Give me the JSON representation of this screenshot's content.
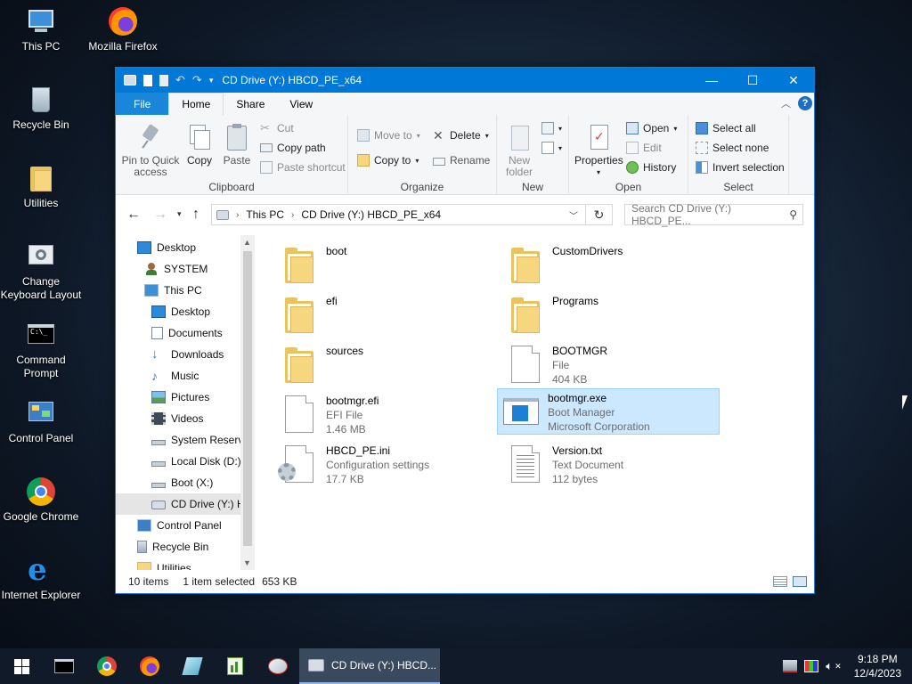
{
  "desktop": {
    "icons": [
      {
        "label": "This PC"
      },
      {
        "label": "Mozilla Firefox"
      },
      {
        "label": "Recycle Bin"
      },
      {
        "label": "Utilities"
      },
      {
        "label": "Change Keyboard Layout"
      },
      {
        "label": "Command Prompt"
      },
      {
        "label": "Control Panel"
      },
      {
        "label": "Google Chrome"
      },
      {
        "label": "Internet Explorer"
      }
    ]
  },
  "window": {
    "title": "CD Drive (Y:) HBCD_PE_x64",
    "minimize": "—",
    "maximize": "☐",
    "close": "✕"
  },
  "ribbon": {
    "tabs": {
      "file": "File",
      "home": "Home",
      "share": "Share",
      "view": "View"
    },
    "clipboard": {
      "label": "Clipboard",
      "pin": "Pin to Quick access",
      "copy": "Copy",
      "paste": "Paste",
      "cut": "Cut",
      "copy_path": "Copy path",
      "paste_shortcut": "Paste shortcut"
    },
    "organize": {
      "label": "Organize",
      "move_to": "Move to",
      "copy_to": "Copy to",
      "delete": "Delete",
      "rename": "Rename"
    },
    "new": {
      "label": "New",
      "new_folder": "New folder"
    },
    "open": {
      "label": "Open",
      "properties": "Properties",
      "open": "Open",
      "edit": "Edit",
      "history": "History"
    },
    "select": {
      "label": "Select",
      "select_all": "Select all",
      "select_none": "Select none",
      "invert": "Invert selection"
    }
  },
  "address": {
    "crumbs": [
      "This PC",
      "CD Drive (Y:) HBCD_PE_x64"
    ],
    "search_placeholder": "Search CD Drive (Y:) HBCD_PE..."
  },
  "navpane": {
    "items": [
      {
        "label": "Desktop"
      },
      {
        "label": "SYSTEM"
      },
      {
        "label": "This PC"
      },
      {
        "label": "Desktop"
      },
      {
        "label": "Documents"
      },
      {
        "label": "Downloads"
      },
      {
        "label": "Music"
      },
      {
        "label": "Pictures"
      },
      {
        "label": "Videos"
      },
      {
        "label": "System Reserve"
      },
      {
        "label": "Local Disk (D:)"
      },
      {
        "label": "Boot (X:)"
      },
      {
        "label": "CD Drive (Y:) H"
      },
      {
        "label": "Control Panel"
      },
      {
        "label": "Recycle Bin"
      },
      {
        "label": "Utilities"
      }
    ]
  },
  "files": [
    {
      "name": "boot",
      "type": "folder"
    },
    {
      "name": "CustomDrivers",
      "type": "folder"
    },
    {
      "name": "efi",
      "type": "folder"
    },
    {
      "name": "Programs",
      "type": "folder"
    },
    {
      "name": "sources",
      "type": "folder"
    },
    {
      "name": "BOOTMGR",
      "line1": "File",
      "line2": "404 KB",
      "type": "file"
    },
    {
      "name": "bootmgr.efi",
      "line1": "EFI File",
      "line2": "1.46 MB",
      "type": "file"
    },
    {
      "name": "bootmgr.exe",
      "line1": "Boot Manager",
      "line2": "Microsoft Corporation",
      "type": "exe",
      "selected": true
    },
    {
      "name": "HBCD_PE.ini",
      "line1": "Configuration settings",
      "line2": "17.7 KB",
      "type": "ini"
    },
    {
      "name": "Version.txt",
      "line1": "Text Document",
      "line2": "112 bytes",
      "type": "txt"
    }
  ],
  "status": {
    "count": "10 items",
    "selected": "1 item selected",
    "size": "653 KB"
  },
  "taskbar": {
    "active_task": "CD Drive (Y:) HBCD...",
    "time": "9:18 PM",
    "date": "12/4/2023"
  },
  "colors": {
    "accent": "#0078d7",
    "selection": "#cce8ff",
    "folder": "#e8c35f",
    "taskbar": "#101a28"
  }
}
